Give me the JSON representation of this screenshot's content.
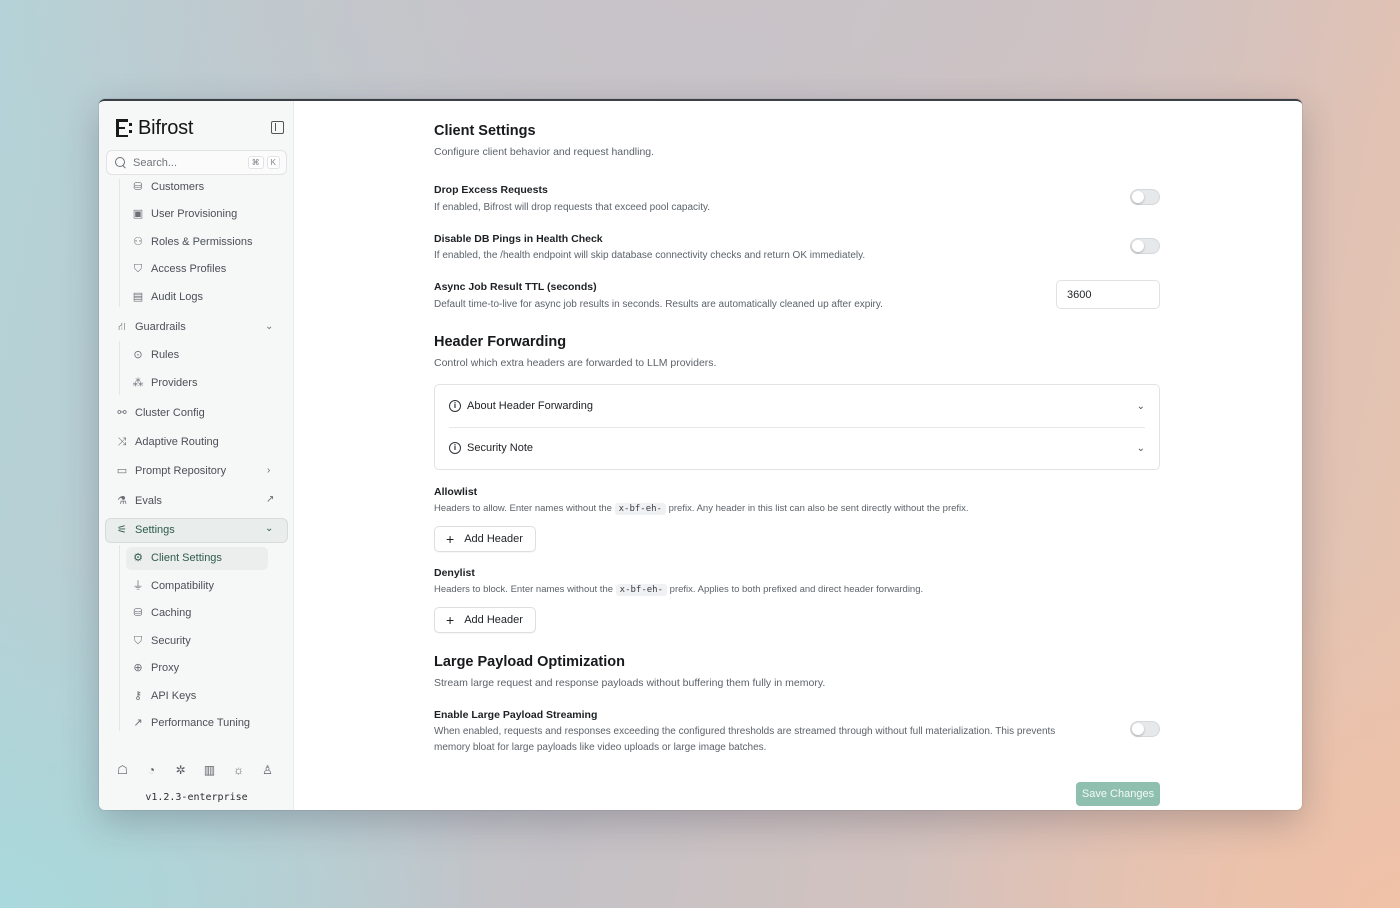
{
  "app": {
    "name": "Bifrost",
    "version": "v1.2.3-enterprise"
  },
  "search": {
    "placeholder": "Search...",
    "shortcut_keys": [
      "⌘",
      "K"
    ]
  },
  "sidebar": {
    "top_sub_items": [
      {
        "label": "Customers",
        "icon": "database-icon"
      },
      {
        "label": "User Provisioning",
        "icon": "id-card-icon"
      },
      {
        "label": "Roles & Permissions",
        "icon": "user-icon"
      },
      {
        "label": "Access Profiles",
        "icon": "shield-icon"
      },
      {
        "label": "Audit Logs",
        "icon": "scroll-icon"
      }
    ],
    "guardrails": {
      "label": "Guardrails",
      "icon": "guardrails-icon",
      "expanded": true
    },
    "guardrails_items": [
      {
        "label": "Rules",
        "icon": "search-check-icon"
      },
      {
        "label": "Providers",
        "icon": "boxes-icon"
      }
    ],
    "main_items": [
      {
        "label": "Cluster Config",
        "icon": "network-icon"
      },
      {
        "label": "Adaptive Routing",
        "icon": "shuffle-icon"
      },
      {
        "label": "Prompt Repository",
        "icon": "folder-icon"
      },
      {
        "label": "Evals",
        "icon": "flask-icon"
      }
    ],
    "settings": {
      "label": "Settings",
      "icon": "sliders-icon",
      "expanded": true
    },
    "settings_items": [
      {
        "label": "Client Settings",
        "icon": "gear-icon",
        "active": true
      },
      {
        "label": "Compatibility",
        "icon": "plug-icon"
      },
      {
        "label": "Caching",
        "icon": "database-icon"
      },
      {
        "label": "Security",
        "icon": "shield-icon"
      },
      {
        "label": "Proxy",
        "icon": "globe-icon"
      },
      {
        "label": "API Keys",
        "icon": "key-icon"
      },
      {
        "label": "Performance Tuning",
        "icon": "trending-up-icon"
      }
    ],
    "bottom_icons": [
      "discord-icon",
      "github-icon",
      "bug-icon",
      "docs-icon",
      "sun-icon",
      "user-icon"
    ]
  },
  "client_settings": {
    "title": "Client Settings",
    "description": "Configure client behavior and request handling.",
    "drop_excess": {
      "label": "Drop Excess Requests",
      "description": "If enabled, Bifrost will drop requests that exceed pool capacity.",
      "enabled": false
    },
    "disable_db_pings": {
      "label": "Disable DB Pings in Health Check",
      "description": "If enabled, the /health endpoint will skip database connectivity checks and return OK immediately.",
      "enabled": false
    },
    "async_ttl": {
      "label": "Async Job Result TTL (seconds)",
      "description": "Default time-to-live for async job results in seconds. Results are automatically cleaned up after expiry.",
      "value": "3600"
    }
  },
  "header_forwarding": {
    "title": "Header Forwarding",
    "description": "Control which extra headers are forwarded to LLM providers.",
    "accordion": [
      {
        "label": "About Header Forwarding"
      },
      {
        "label": "Security Note"
      }
    ],
    "allowlist": {
      "label": "Allowlist",
      "desc_before": "Headers to allow. Enter names without the",
      "prefix": "x-bf-eh-",
      "desc_after": "prefix. Any header in this list can also be sent directly without the prefix.",
      "button": "Add Header"
    },
    "denylist": {
      "label": "Denylist",
      "desc_before": "Headers to block. Enter names without the",
      "prefix": "x-bf-eh-",
      "desc_after": "prefix. Applies to both prefixed and direct header forwarding.",
      "button": "Add Header"
    }
  },
  "large_payload": {
    "title": "Large Payload Optimization",
    "description": "Stream large request and response payloads without buffering them fully in memory.",
    "streaming": {
      "label": "Enable Large Payload Streaming",
      "description_line1": "When enabled, requests and responses exceeding the configured thresholds are streamed through without full materialization. This prevents",
      "description_line2": "memory bloat for large payloads like video uploads or large image batches.",
      "enabled": false
    }
  },
  "actions": {
    "save": "Save Changes"
  },
  "colors": {
    "accent": "#8fbfae",
    "active_bg": "#e9edec"
  }
}
